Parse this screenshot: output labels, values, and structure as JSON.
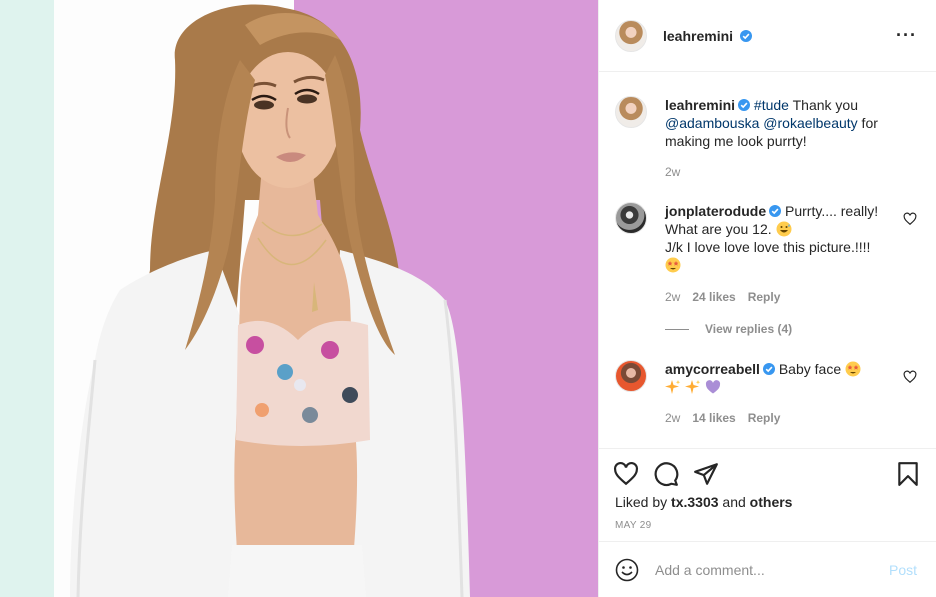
{
  "post": {
    "author": "leahremini",
    "verified": true,
    "more_icon": "more-options-icon"
  },
  "caption": {
    "author": "leahremini",
    "hashtag": "#tude",
    "text_1": " Thank you ",
    "mention_1": "@adambouska",
    "mention_2": "@rokaelbeauty",
    "text_2": " for making me look purrty!",
    "time": "2w"
  },
  "comments": [
    {
      "author": "jonplaterodude",
      "verified": true,
      "text": "Purrty.... really! What are you 12.",
      "text_2": "J/k I love love love this picture.!!!!",
      "emojis": [
        "grinning-sweat-face",
        "star-struck-face"
      ],
      "time": "2w",
      "likes": "24 likes",
      "reply": "Reply",
      "view_replies": "View replies (4)"
    },
    {
      "author": "amycorreabell",
      "verified": true,
      "text": "Baby face",
      "emojis": [
        "star-struck-face",
        "sparkles",
        "sparkles",
        "purple-heart"
      ],
      "time": "2w",
      "likes": "14 likes",
      "reply": "Reply"
    }
  ],
  "actions": {
    "icons": [
      "heart-icon",
      "comment-icon",
      "share-icon",
      "bookmark-icon"
    ],
    "liked_prefix": "Liked by ",
    "liked_user": "tx.3303",
    "liked_and": " and ",
    "liked_others": "others",
    "date": "MAY 29"
  },
  "add_comment": {
    "placeholder": "Add a comment...",
    "post_label": "Post",
    "post_color": "#b2dffc"
  },
  "colors": {
    "verified": "#3897f0",
    "link": "#00376b",
    "muted": "#8e8e8e",
    "photo_purple": "#d89ad8",
    "photo_mint": "#dff3ee"
  }
}
